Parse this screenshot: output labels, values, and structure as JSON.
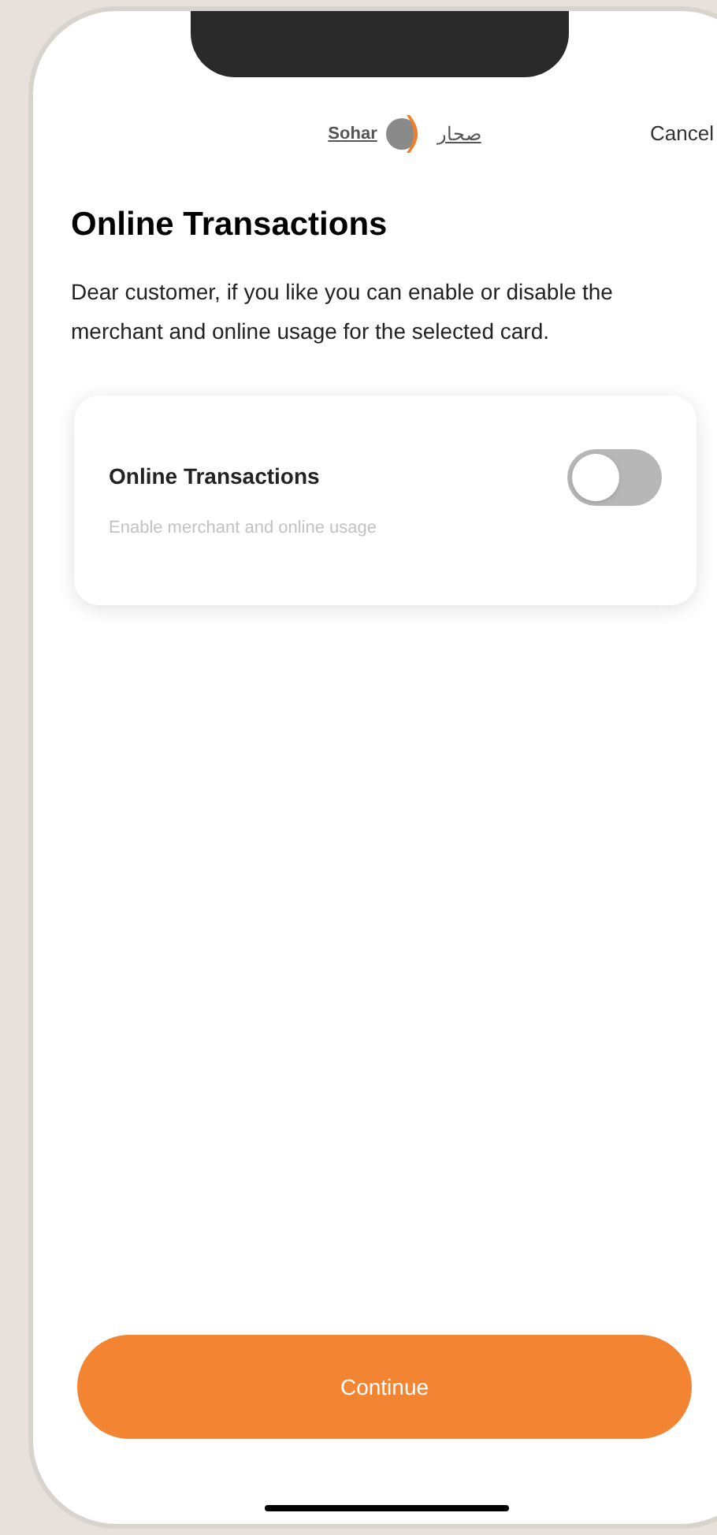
{
  "header": {
    "logo_latin": "Sohar",
    "logo_arabic": "صحار",
    "cancel": "Cancel"
  },
  "title": "Online Transactions",
  "description": "Dear customer, if you like you can enable or disable the merchant and online usage for the selected card.",
  "setting": {
    "label": "Online Transactions",
    "hint": "Enable merchant and online usage",
    "on": false
  },
  "continue_button": "Continue"
}
